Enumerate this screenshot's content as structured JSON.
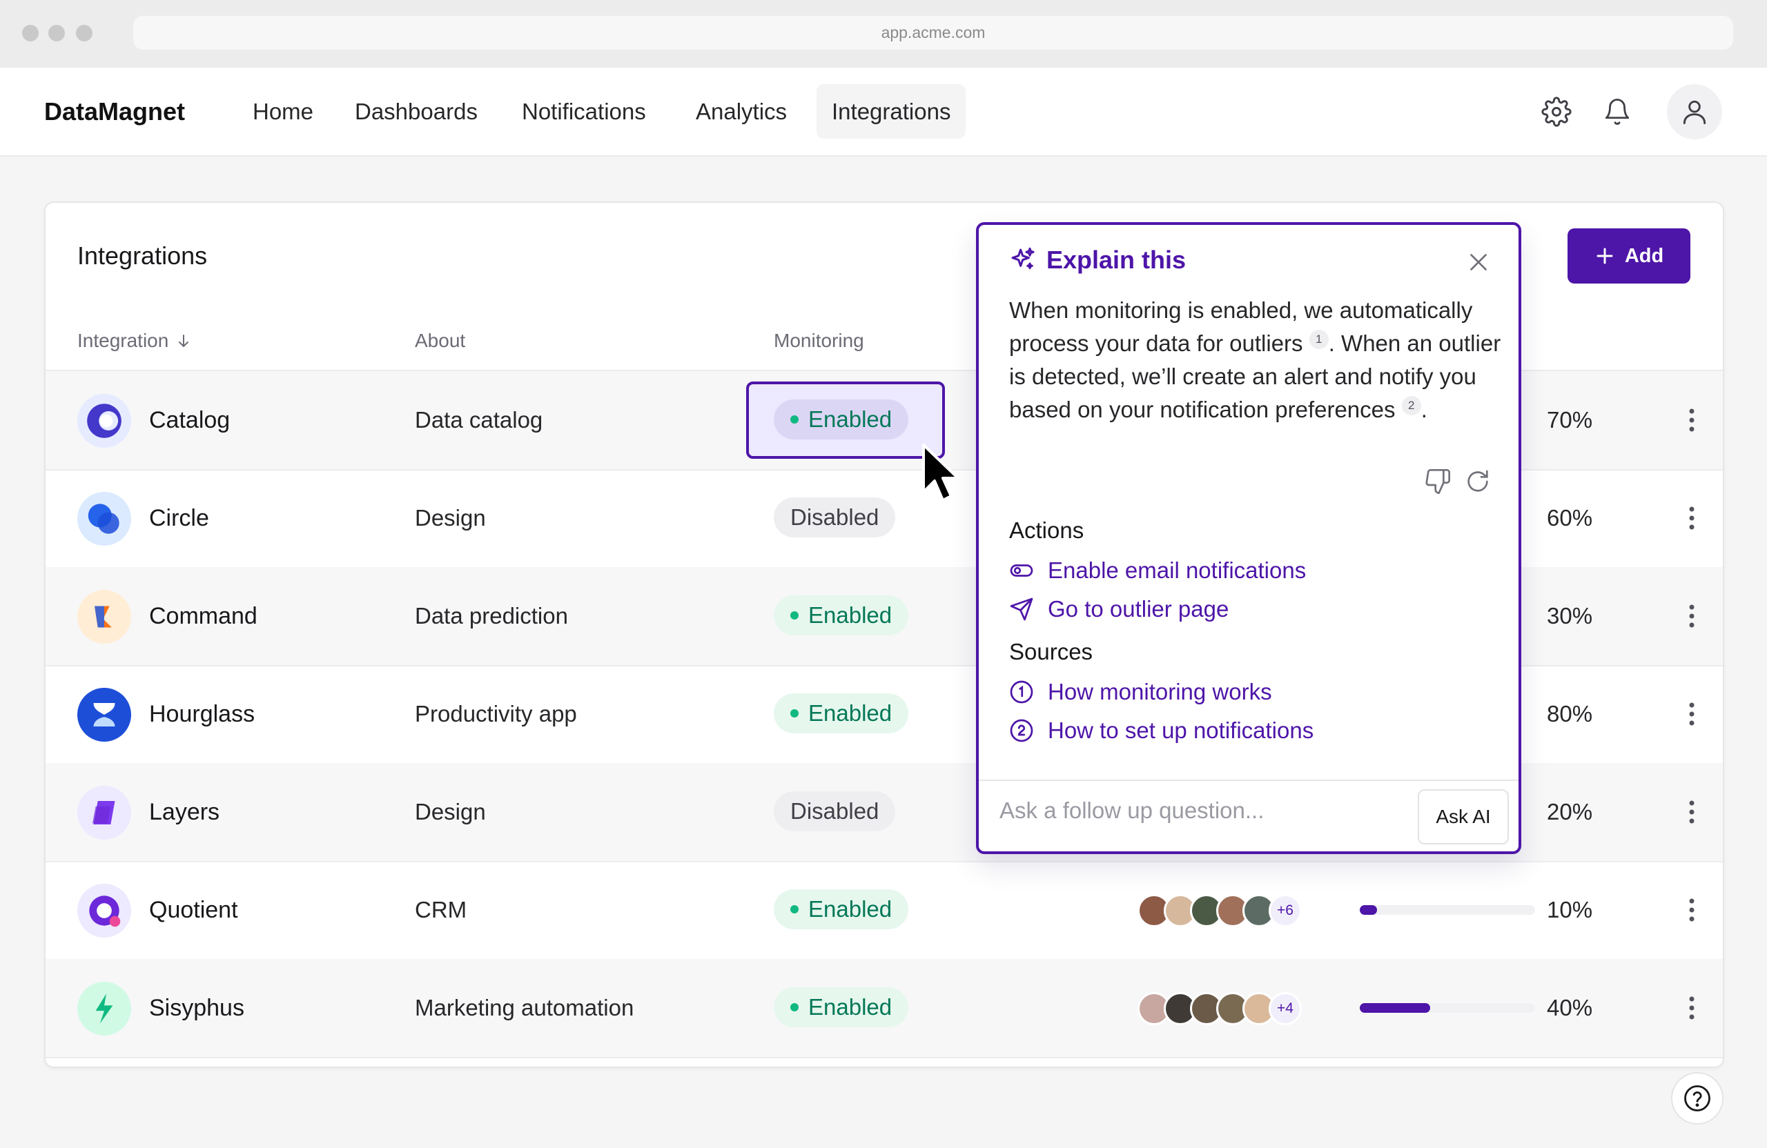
{
  "browser": {
    "url": "app.acme.com"
  },
  "nav": {
    "brand": "DataMagnet",
    "links": [
      "Home",
      "Dashboards",
      "Notifications",
      "Analytics",
      "Integrations"
    ],
    "active": "Integrations",
    "icons": [
      "gear-icon",
      "bell-icon",
      "user-icon"
    ]
  },
  "table": {
    "title": "Integrations",
    "add_label": "Add",
    "columns": {
      "integration": "Integration",
      "about": "About",
      "monitoring": "Monitoring"
    },
    "rows": [
      {
        "name": "Catalog",
        "about": "Data catalog",
        "monitoring": "Enabled",
        "progress": "70%"
      },
      {
        "name": "Circle",
        "about": "Design",
        "monitoring": "Disabled",
        "progress": "60%"
      },
      {
        "name": "Command",
        "about": "Data prediction",
        "monitoring": "Enabled",
        "progress": "30%"
      },
      {
        "name": "Hourglass",
        "about": "Productivity app",
        "monitoring": "Enabled",
        "progress": "80%"
      },
      {
        "name": "Layers",
        "about": "Design",
        "monitoring": "Disabled",
        "progress": "20%"
      },
      {
        "name": "Quotient",
        "about": "CRM",
        "monitoring": "Enabled",
        "progress": "10%",
        "more_members": "+6"
      },
      {
        "name": "Sisyphus",
        "about": "Marketing automation",
        "monitoring": "Enabled",
        "progress": "40%",
        "more_members": "+4"
      }
    ]
  },
  "explain": {
    "title": "Explain this",
    "body_1": "When monitoring is enabled, we automatically process your data for outliers",
    "ref_1": "1",
    "body_2": ". When an outlier is detected, we’ll create an alert and notify you based on your notification preferences",
    "ref_2": "2",
    "body_3": ".",
    "actions_heading": "Actions",
    "actions": [
      "Enable email notifications",
      "Go to outlier page"
    ],
    "sources_heading": "Sources",
    "sources": [
      "How monitoring works",
      "How to set up notifications"
    ],
    "input_placeholder": "Ask a follow up question...",
    "ask_label": "Ask AI"
  },
  "colors": {
    "accent": "#4d15a8",
    "enabled_text": "#047857",
    "enabled_bg": "#e6f7ee"
  }
}
